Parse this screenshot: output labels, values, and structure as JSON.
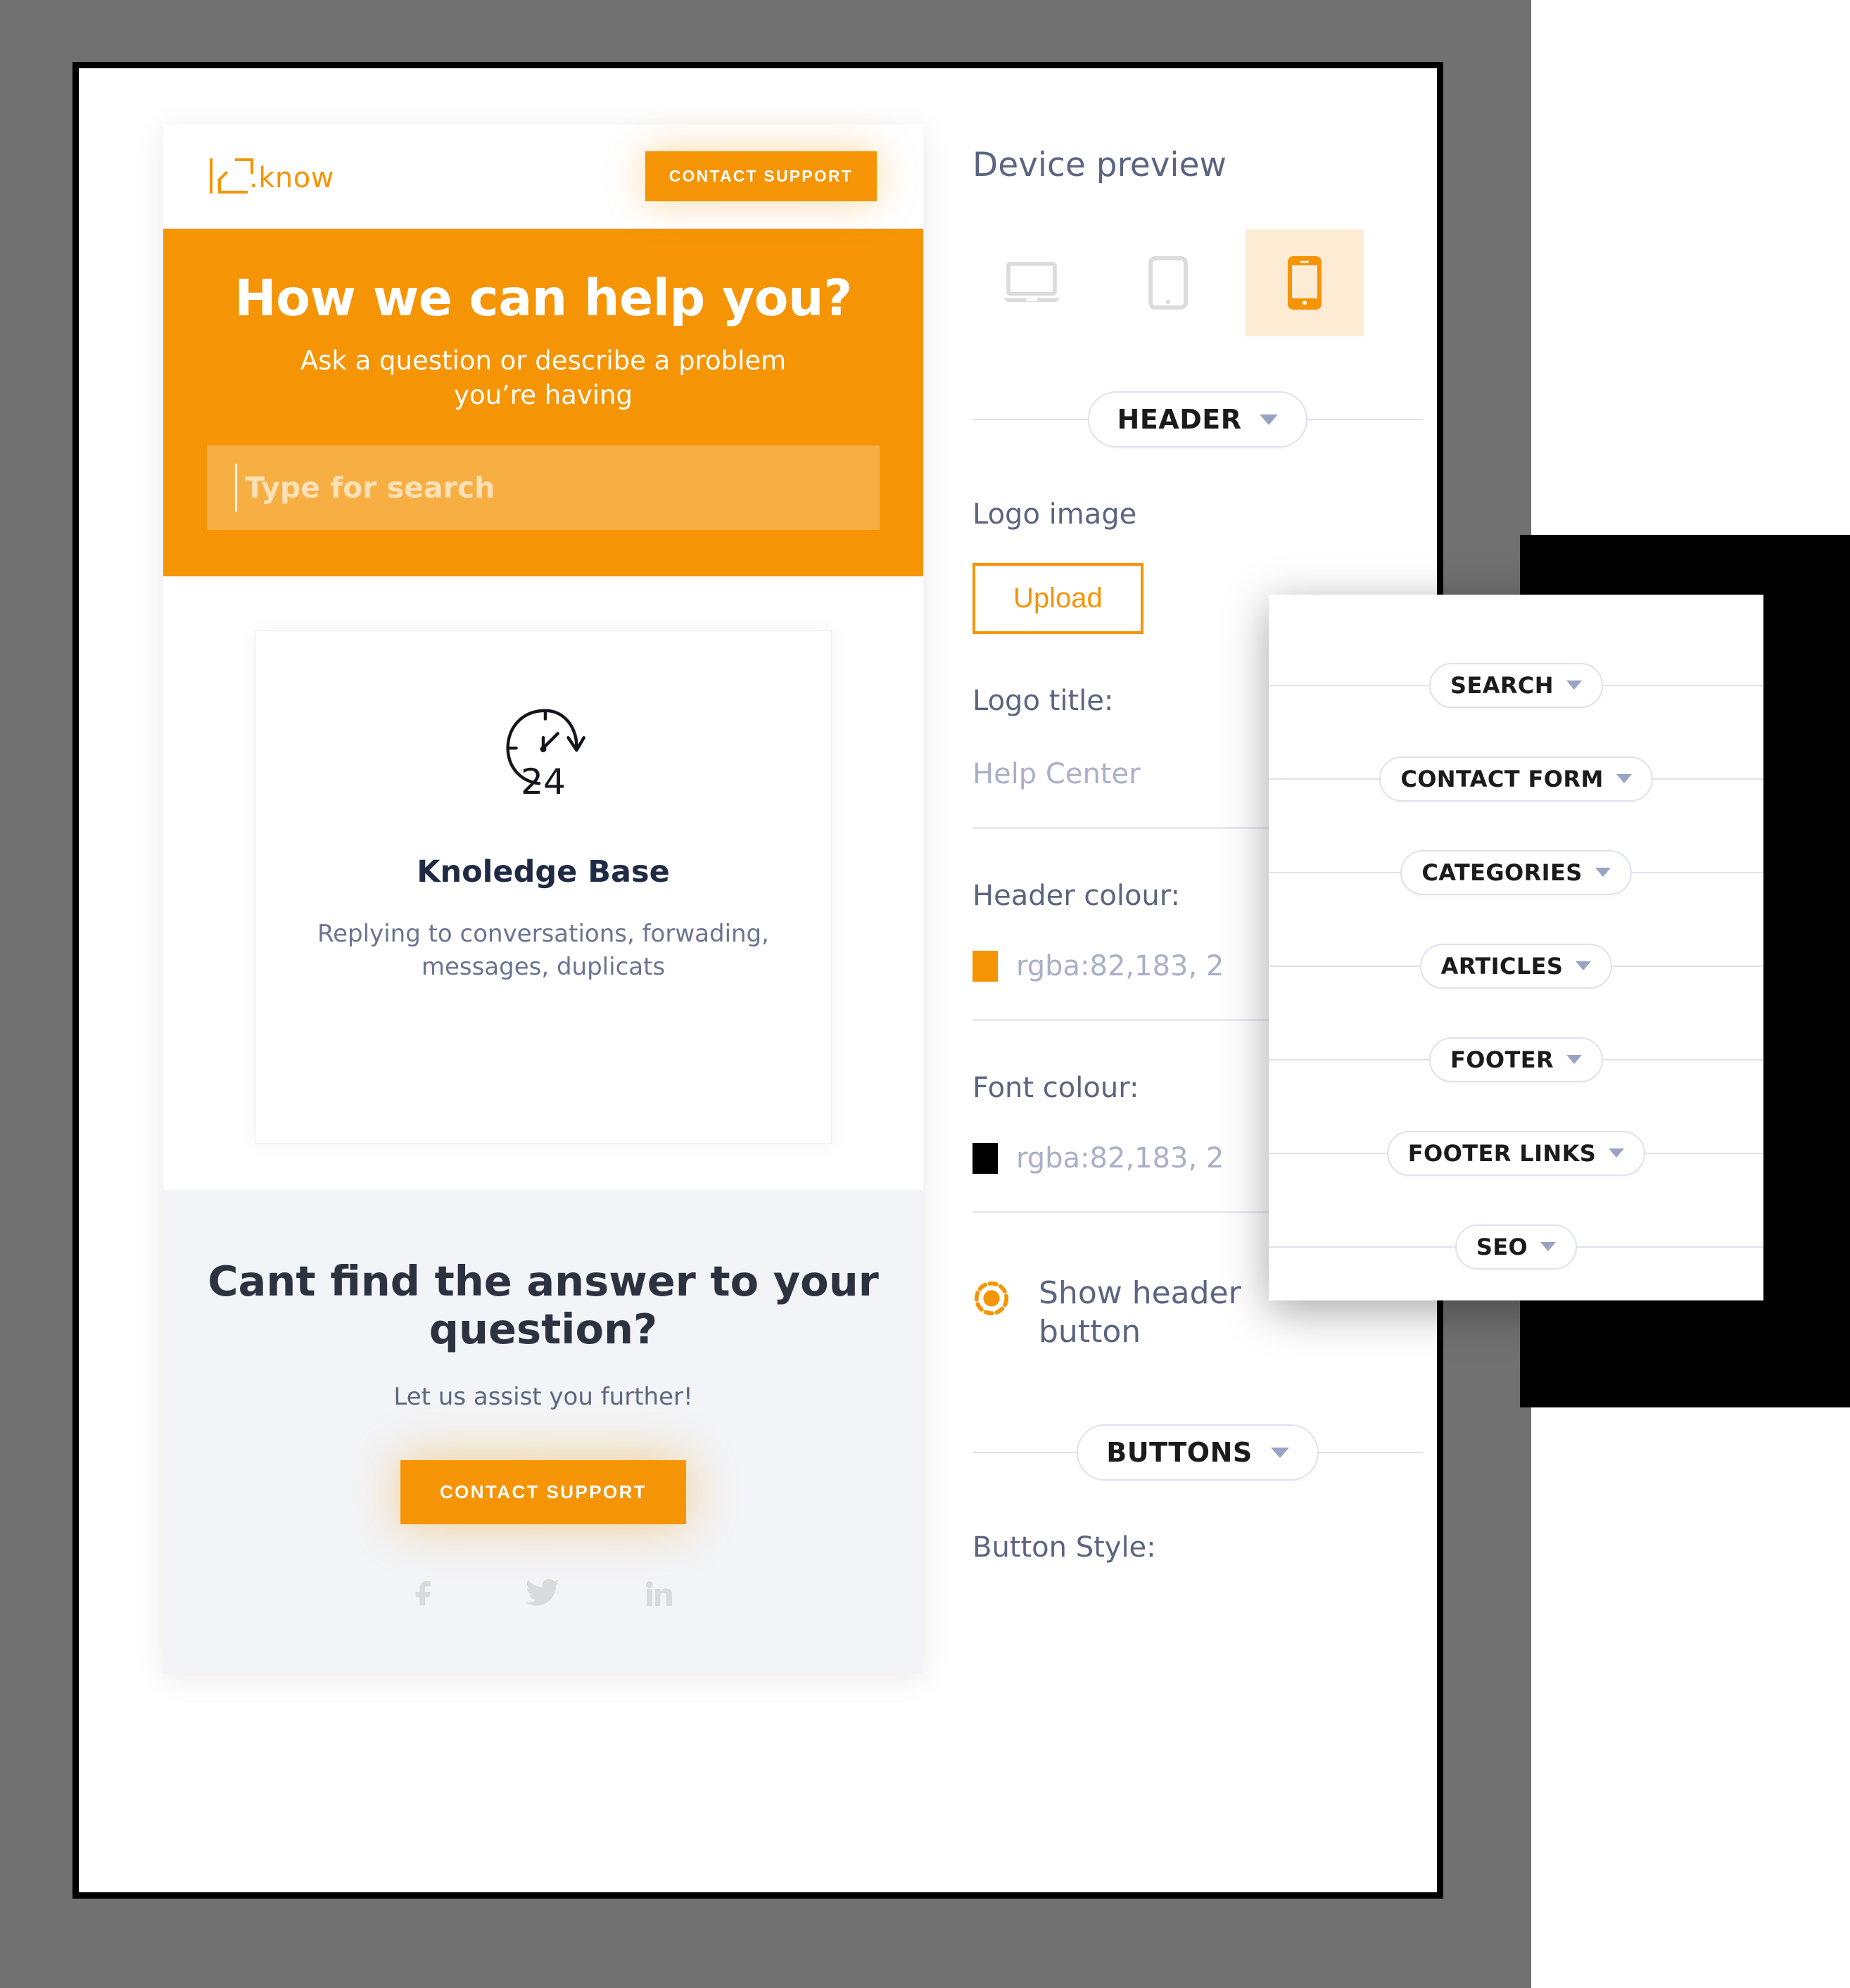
{
  "preview": {
    "topbar": {
      "logo_text": ".know",
      "logo_icon": "bracket-logo-icon",
      "contact_button": "CONTACT SUPPORT"
    },
    "hero": {
      "heading": "How we can help you?",
      "subheading": "Ask a question or describe a problem you’re having",
      "search_placeholder": "Type for search"
    },
    "card": {
      "icon": "clock-24h-icon",
      "title": "Knoledge Base",
      "description": "Replying to conversations, forwading, messages, duplicats"
    },
    "footer": {
      "heading": "Cant find the answer to your question?",
      "subheading": "Let us assist you further!",
      "button": "CONTACT SUPPORT",
      "socials": [
        {
          "name": "facebook-icon",
          "label": "Facebook"
        },
        {
          "name": "twitter-icon",
          "label": "Twitter"
        },
        {
          "name": "linkedin-icon",
          "label": "LinkedIn"
        }
      ]
    }
  },
  "settings": {
    "title": "Device preview",
    "devices": [
      {
        "name": "desktop",
        "label": "Desktop",
        "active": false
      },
      {
        "name": "tablet",
        "label": "Tablet",
        "active": false
      },
      {
        "name": "mobile",
        "label": "Mobile",
        "active": true
      }
    ],
    "header_section": {
      "pill_label": "HEADER",
      "logo_image_label": "Logo image",
      "upload_button": "Upload",
      "logo_title_label": "Logo title:",
      "logo_title_value": "Help Center",
      "header_colour_label": "Header colour:",
      "header_colour_value": "rgba:82,183, 2",
      "header_colour_swatch": "#F59405",
      "font_colour_label": "Font colour:",
      "font_colour_value": "rgba:82,183, 2",
      "font_colour_swatch": "#000000",
      "show_header_button_label": "Show header button",
      "show_header_button_checked": true
    },
    "buttons_section": {
      "pill_label": "BUTTONS",
      "button_style_label": "Button Style:"
    }
  },
  "overlay": {
    "sections": [
      {
        "label": "SEARCH"
      },
      {
        "label": "CONTACT FORM"
      },
      {
        "label": "CATEGORIES"
      },
      {
        "label": "ARTICLES"
      },
      {
        "label": "FOOTER"
      },
      {
        "label": "FOOTER LINKS"
      },
      {
        "label": "SEO"
      }
    ]
  },
  "colors": {
    "brand_orange": "#F59405",
    "background_gray": "#717171",
    "pill_border": "#dfe2f0",
    "label_text": "#5b6480"
  }
}
